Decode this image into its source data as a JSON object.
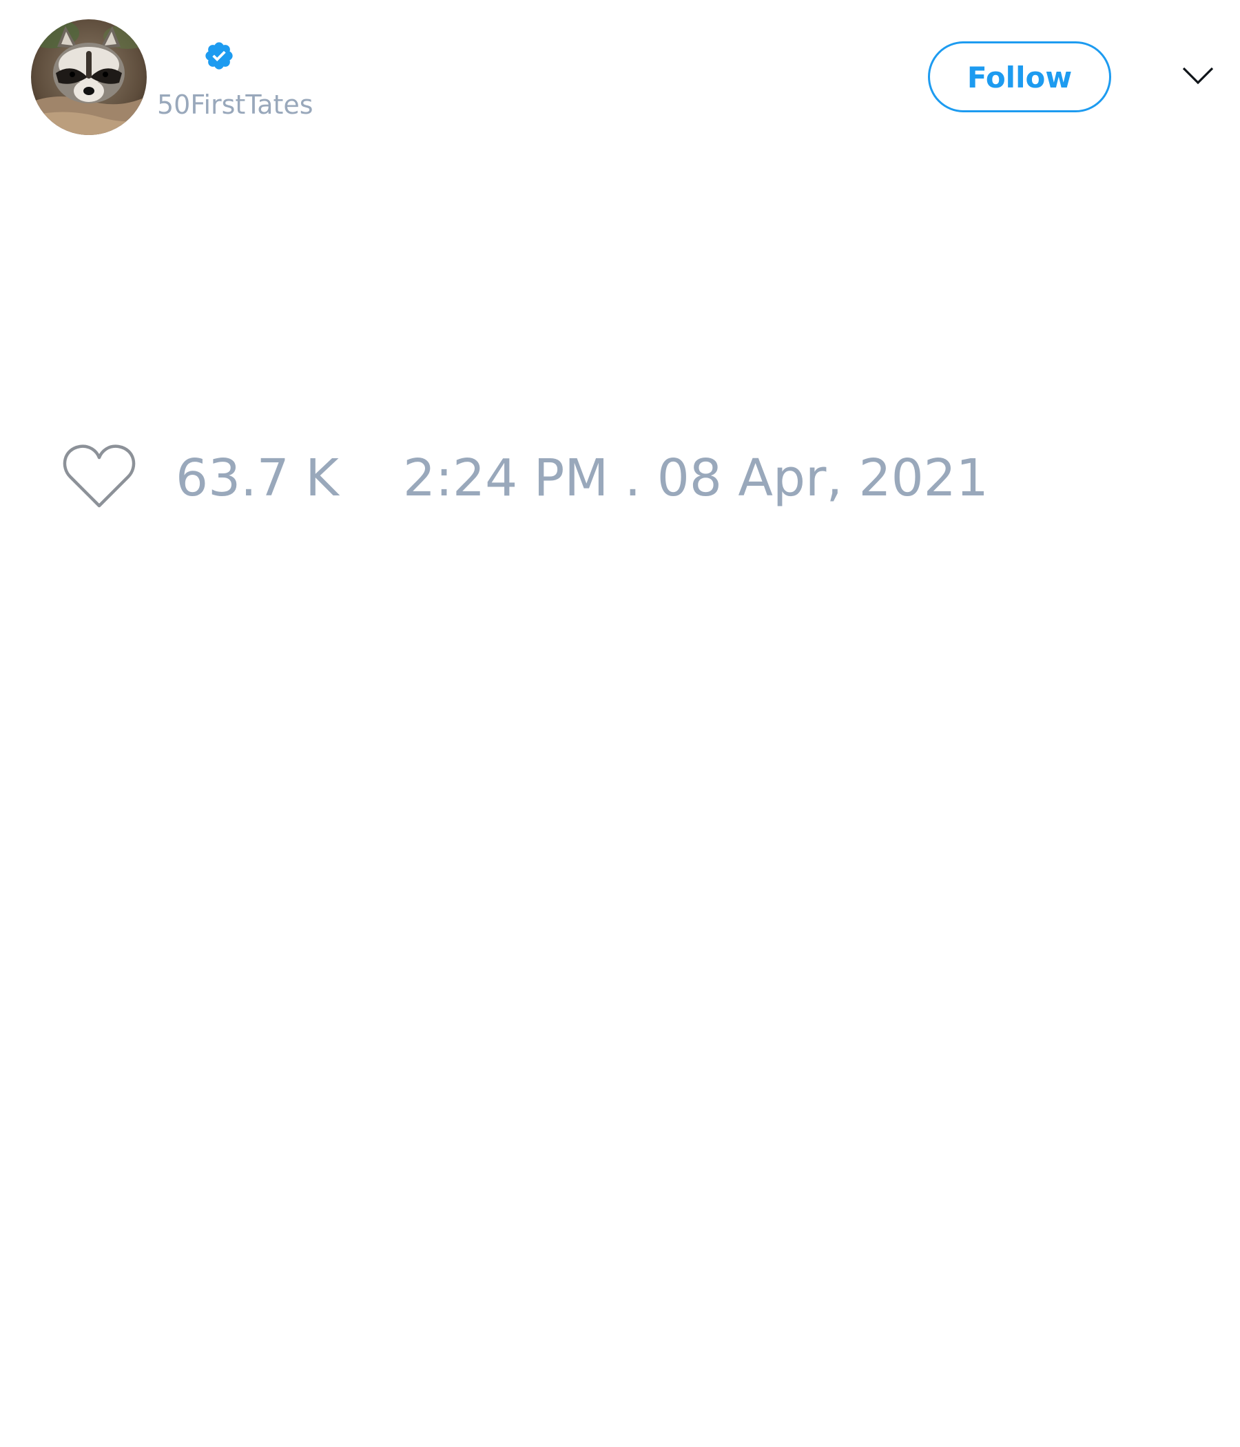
{
  "author": {
    "handle": "50FirstTates",
    "verified": true,
    "avatar_icon": "raccoon-avatar"
  },
  "header": {
    "follow_label": "Follow",
    "menu_icon": "chevron-down-icon"
  },
  "tweet": {
    "like_icon": "heart-outline-icon",
    "like_count": "63.7 K",
    "timestamp": "2:24 PM . 08 Apr, 2021"
  },
  "colors": {
    "accent": "#1d9bf0",
    "muted_text": "#99a8bb",
    "background": "#ffffff"
  }
}
